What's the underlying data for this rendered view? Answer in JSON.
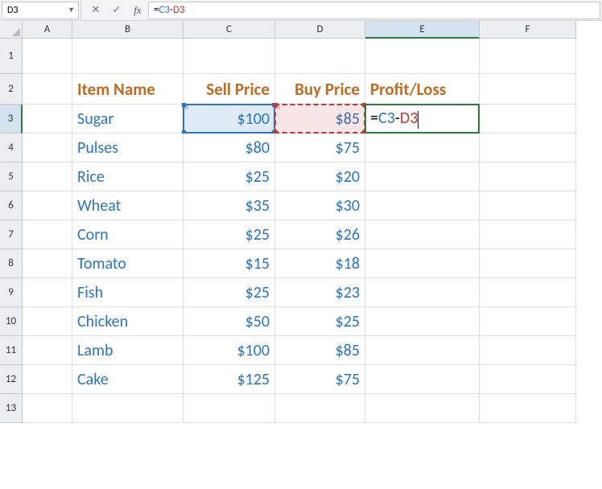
{
  "name_box": "D3",
  "formula_bar": {
    "eq": "=",
    "ref1": "C3",
    "op": "-",
    "ref2": "D3"
  },
  "columns": [
    "A",
    "B",
    "C",
    "D",
    "E",
    "F"
  ],
  "active_col": "E",
  "active_row": 3,
  "headers": {
    "B": "Item Name",
    "C": "Sell Price",
    "D": "Buy Price",
    "E": "Profit/Loss"
  },
  "edit_cell": {
    "eq": "=",
    "ref1": "C3",
    "op": "-",
    "ref2": "D3"
  },
  "data_rows": [
    {
      "n": 3,
      "item": "Sugar",
      "sell": "$100",
      "buy": "$85"
    },
    {
      "n": 4,
      "item": "Pulses",
      "sell": "$80",
      "buy": "$75"
    },
    {
      "n": 5,
      "item": "Rice",
      "sell": "$25",
      "buy": "$20"
    },
    {
      "n": 6,
      "item": "Wheat",
      "sell": "$35",
      "buy": "$30"
    },
    {
      "n": 7,
      "item": "Corn",
      "sell": "$25",
      "buy": "$26"
    },
    {
      "n": 8,
      "item": "Tomato",
      "sell": "$15",
      "buy": "$18"
    },
    {
      "n": 9,
      "item": "Fish",
      "sell": "$25",
      "buy": "$23"
    },
    {
      "n": 10,
      "item": "Chicken",
      "sell": "$50",
      "buy": "$25"
    },
    {
      "n": 11,
      "item": "Lamb",
      "sell": "$100",
      "buy": "$85"
    },
    {
      "n": 12,
      "item": "Cake",
      "sell": "$125",
      "buy": "$75"
    }
  ],
  "chart_data": {
    "type": "table",
    "columns": [
      "Item Name",
      "Sell Price",
      "Buy Price",
      "Profit/Loss"
    ],
    "rows": [
      [
        "Sugar",
        100,
        85,
        null
      ],
      [
        "Pulses",
        80,
        75,
        null
      ],
      [
        "Rice",
        25,
        20,
        null
      ],
      [
        "Wheat",
        35,
        30,
        null
      ],
      [
        "Corn",
        25,
        26,
        null
      ],
      [
        "Tomato",
        15,
        18,
        null
      ],
      [
        "Fish",
        25,
        23,
        null
      ],
      [
        "Chicken",
        50,
        25,
        null
      ],
      [
        "Lamb",
        100,
        85,
        null
      ],
      [
        "Cake",
        125,
        75,
        null
      ]
    ],
    "formula_E3": "=C3-D3"
  }
}
